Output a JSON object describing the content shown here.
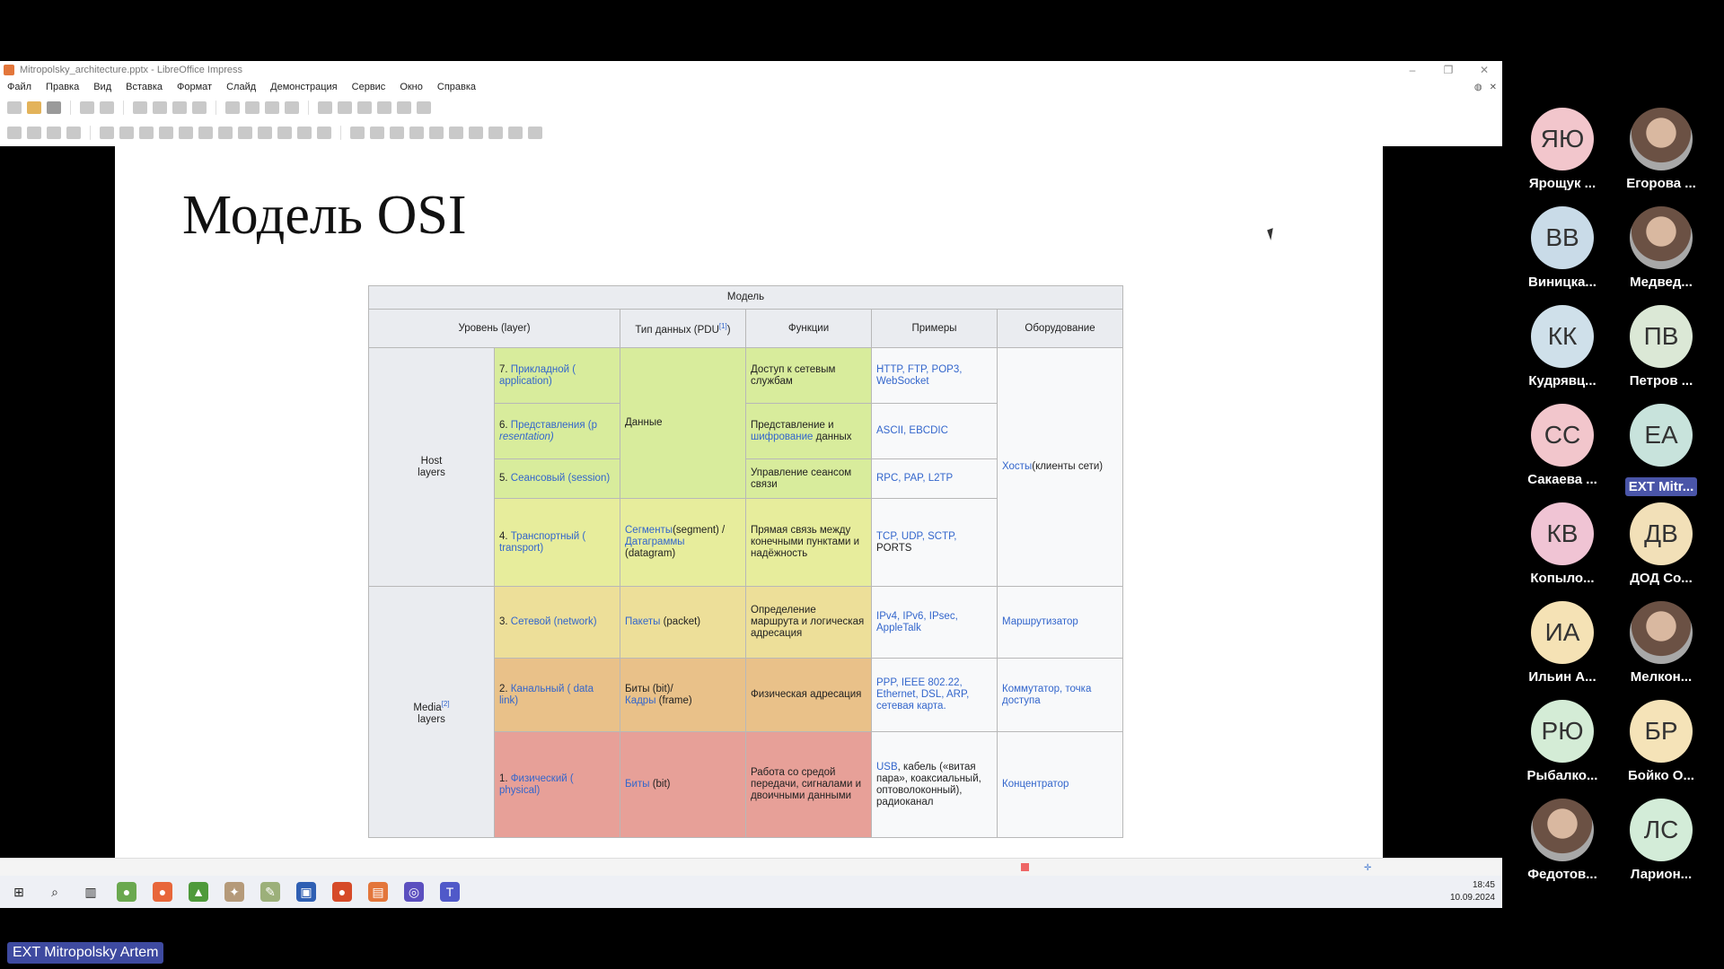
{
  "window": {
    "title": "Mitropolsky_architecture.pptx - LibreOffice Impress",
    "controls": [
      "–",
      "❐",
      "✕"
    ]
  },
  "menu": [
    "Файл",
    "Правка",
    "Вид",
    "Вставка",
    "Формат",
    "Слайд",
    "Демонстрация",
    "Сервис",
    "Окно",
    "Справка"
  ],
  "slide": {
    "title": "Модель OSI",
    "table": {
      "caption": "Модель",
      "headers": {
        "layer": "Уровень (layer)",
        "pdu": "Тип данных (PDU",
        "pdu_sup": "[1]",
        "functions": "Функции",
        "examples": "Примеры",
        "hardware": "Оборудование"
      },
      "groups": {
        "host": "Host\nlayers",
        "media": "Media",
        "media_sup": "[2]",
        "media_tail": "layers"
      },
      "rows": {
        "app_layer_num": "7.",
        "app_layer": "Прикладной ( application)",
        "pres_layer_num": "6.",
        "pres_layer": "Представления (p",
        "pres_layer_it": "resentation)",
        "sess_layer_num": "5.",
        "sess_layer": "Сеансовый (session)",
        "trans_layer_num": "4.",
        "trans_layer": "Транспортный ( transport)",
        "net_layer_num": "3.",
        "net_layer": "Сетевой (network)",
        "dl_layer_num": "2.",
        "dl_layer": "Канальный ( data link)",
        "ph_layer_num": "1.",
        "ph_layer": "Физический ( physical)",
        "pdu_data": "Данные",
        "pdu_seg_link": "Сегменты",
        "pdu_seg_text": "(segment) /",
        "pdu_dgram_link": "Датаграммы",
        "pdu_dgram_text": "(datagram)",
        "pdu_packets_link": "Пакеты",
        "pdu_packets_text": " (packet)",
        "pdu_bits_text": "Биты (bit)/",
        "pdu_frames_link": "Кадры",
        "pdu_frames_text": " (frame)",
        "pdu_bit_link": "Биты",
        "pdu_bit_text": " (bit)",
        "fn_app": "Доступ к сетевым службам",
        "fn_pres_a": "Представление и ",
        "fn_pres_link": "шифрование",
        "fn_pres_b": " данных",
        "fn_sess": "Управление сеансом связи",
        "fn_trans": "Прямая связь между конечными пунктами и надёжность",
        "fn_net": "Определение маршрута и логическая адресация",
        "fn_dl": "Физическая адресация",
        "fn_ph": "Работа со средой передачи, сигналами и двоичными данными",
        "ex_app": "HTTP, FTP, POP3, WebSocket",
        "ex_pres": "ASCII, EBCDIC",
        "ex_sess": "RPC, PAP, L2TP",
        "ex_trans_links": "TCP, UDP, SCTP,",
        "ex_trans_text": " PORTS",
        "ex_net": "IPv4, IPv6, IPsec, AppleTalk",
        "ex_dl": "PPP, IEEE 802.22, Ethernet, DSL, ARP, сетевая карта.",
        "ex_ph_link": "USB",
        "ex_ph_text": ", кабель («витая пара», коаксиальный, оптоволоконный), радиоканал",
        "hw_hosts_link": "Хосты",
        "hw_hosts_text": "(клиенты сети)",
        "hw_router": "Маршрутизатор",
        "hw_switch": "Коммутатор, точка доступа",
        "hw_hub": "Концентратор"
      }
    }
  },
  "clock": {
    "time": "18:45",
    "date": "10.09.2024"
  },
  "participants": [
    {
      "initials": "ЯЮ",
      "name": "Ярощук ...",
      "color": "#f2c6cc"
    },
    {
      "initials": "",
      "name": "Егорова ...",
      "color": "",
      "photo": true
    },
    {
      "initials": "ВВ",
      "name": "Виницка...",
      "color": "#c9dbe8"
    },
    {
      "initials": "",
      "name": "Медвед...",
      "color": "",
      "photo": true
    },
    {
      "initials": "КК",
      "name": "Кудрявц...",
      "color": "#cfe0ea"
    },
    {
      "initials": "ПВ",
      "name": "Петров ...",
      "color": "#dbe8d6"
    },
    {
      "initials": "СС",
      "name": "Сакаева ...",
      "color": "#f2c6cc"
    },
    {
      "initials": "ЕА",
      "name": "EXT Mitr...",
      "color": "#c8e3dc",
      "tag": true
    },
    {
      "initials": "КВ",
      "name": "Копыло...",
      "color": "#f0c4d4"
    },
    {
      "initials": "ДВ",
      "name": "ДОД Со...",
      "color": "#f2e0b8"
    },
    {
      "initials": "ИА",
      "name": "Ильин А...",
      "color": "#f5e2b5"
    },
    {
      "initials": "",
      "name": "Мелкон...",
      "color": "",
      "photo": true
    },
    {
      "initials": "РЮ",
      "name": "Рыбалко...",
      "color": "#d4ecd6"
    },
    {
      "initials": "БР",
      "name": "Бойко О...",
      "color": "#f5e3b8"
    },
    {
      "initials": "",
      "name": "Федотов...",
      "color": "",
      "photo": true
    },
    {
      "initials": "ЛС",
      "name": "Ларион...",
      "color": "#d3ecd8"
    }
  ],
  "presenter_label": "EXT Mitropolsky Artem"
}
